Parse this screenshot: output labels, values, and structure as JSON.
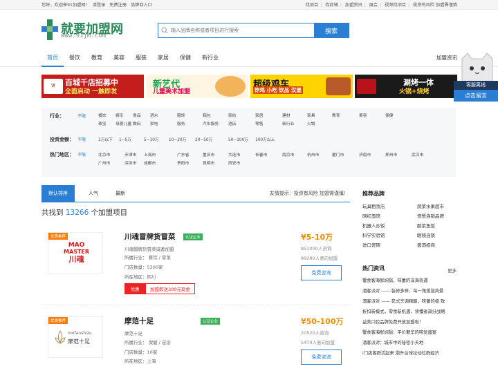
{
  "topbar": {
    "welcome": "您好，欢迎来91加盟网！",
    "login": "请登录",
    "register": "免费注册",
    "brand_entry": "品牌商入口",
    "links": [
      "找项目",
      "找商铺",
      "加盟资讯",
      "展会",
      "视频找项目",
      "投资有风险 加盟需谨慎"
    ]
  },
  "logo": {
    "name": "就要加盟网",
    "url": "www.91jm.com"
  },
  "search": {
    "placeholder": "输入品牌名称或者项目进行搜索",
    "button": "搜索"
  },
  "nav": {
    "items": [
      "首页",
      "餐饮",
      "教育",
      "美容",
      "服装",
      "家居",
      "保健",
      "新行业"
    ],
    "right": "加盟资讯"
  },
  "banners": [
    {
      "line1": "百城千店招募中",
      "line2": "全面启动 一触即发"
    },
    {
      "line1": "新艺代",
      "line2": "儿童美术加盟"
    },
    {
      "line1": "超级鸡车",
      "line2": "炸鸡 小吃 饮品 汉堡"
    },
    {
      "line1": "涮烤一体",
      "line2": "火锅+烧烤"
    }
  ],
  "filters": {
    "industry_label": "行业：",
    "industry_all": "不限",
    "industry_row1": [
      "餐饮",
      "娱乐",
      "食品",
      "酒水",
      "服饰",
      "箱包",
      "家纺",
      "家居",
      "建材",
      "家具",
      "教育",
      "美容",
      "保健"
    ],
    "industry_row2": [
      "珠宝",
      "母婴儿童",
      "数码",
      "家电",
      "服务",
      "汽车服务",
      "酒店",
      "零售",
      "新行业",
      "火锅"
    ],
    "invest_label": "投资金额：",
    "invest_all": "不限",
    "invest": [
      "1万以下",
      "1~5万",
      "5~10万",
      "10~20万",
      "20~50万",
      "50~100万",
      "100万以上"
    ],
    "region_label": "热门地区：",
    "region_all": "不限",
    "region_row1": [
      "北京市",
      "天津市",
      "上海市",
      "广东省",
      "重庆市",
      "大连市",
      "长春市",
      "南京市",
      "杭州市",
      "厦门市",
      "济南市",
      "郑州市",
      "武汉市"
    ],
    "region_row2": [
      "广州市",
      "深圳市",
      "成都市",
      "贵阳市",
      "昆明市",
      "西安市"
    ]
  },
  "tabs": {
    "items": [
      "默认排序",
      "人气",
      "最新"
    ],
    "tip": "友情提示：投资有风险 加盟需谨慎！"
  },
  "total": {
    "prefix": "共找到",
    "count": "13266",
    "suffix": "个加盟项目"
  },
  "cards": [
    {
      "badge": "优质推荐",
      "logo_line1": "MAO",
      "logo_line2": "MASTER",
      "logo_line3": "川魂",
      "title": "川魂冒牌货冒菜",
      "cert": "认证企业",
      "desc": "川魂帽牌货冒菜诚邀加盟",
      "industry": "所属行业： 餐饮 / 冒菜",
      "stores": "门店数量：5300家",
      "region": "所在地区：四川",
      "price": "¥5-10万",
      "consults": "851000人咨询",
      "intents": "89280人意向加盟",
      "consult_btn": "免费咨询",
      "promo_tag": "优惠",
      "promo_text": "加盟即送300元现金"
    },
    {
      "badge": "优质推荐",
      "logo_line1": "mofanshizu",
      "logo_line2": "摩范十足",
      "title": "摩范十足",
      "cert": "认证企业",
      "desc": "摩范十足",
      "industry": "所属行业： 保健 / 足浴",
      "stores": "门店数量：10家",
      "region": "所在地区：上海",
      "price": "¥50-100万",
      "consults": "20520人咨询",
      "intents": "5470人意向加盟",
      "consult_btn": "免费咨询"
    }
  ],
  "sidebar": {
    "brands_title": "推荐品牌",
    "brands": [
      "玩具租赁店",
      "蔬菜水果超市",
      "网红面馆",
      "快餐连锁品牌",
      "机器人炒饭",
      "酸菜鱼饭",
      "科学实验馆",
      "眼镜连锁",
      "进口瓷砖",
      "酱酒招商"
    ],
    "news_title": "热门资讯",
    "news_more": "更多",
    "news": [
      "蟹食客海鲜焖锅，味蕾的深海奇遇",
      "酒客派对 —— 装修多样，每一角落皆风景",
      "酒客派对 —— 花式烹调精酿，味蕾的极 致",
      "折扣新模式，零食新机遇，读懂省满分战略",
      "益美口腔品牌免费开放加盟啦！",
      "蟹食客海鲜焖锅：平价奢华的味觉盛宴",
      "酒客派对：城市中的秘密小天地",
      "i门店客群活起来 鼎升台球拉动社群经济"
    ]
  },
  "kefu": {
    "status": "客服离线",
    "message": "点击留言"
  }
}
